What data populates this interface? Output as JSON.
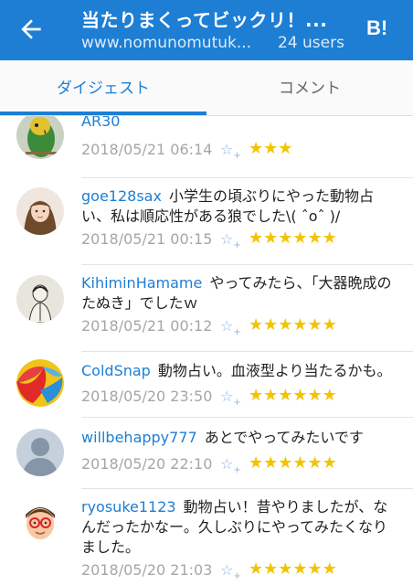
{
  "header": {
    "title": "当たりまくってビックリ！...",
    "url": "www.nomunomutuk...",
    "users": "24 users",
    "hatena_label": "B!"
  },
  "tabs": [
    {
      "label": "ダイジェスト",
      "active": true
    },
    {
      "label": "コメント",
      "active": false
    }
  ],
  "add_star_glyph": "☆",
  "add_star_plus": "+",
  "comments": [
    {
      "user": "AR30",
      "text": "",
      "date": "2018/05/21 06:14",
      "stars": "★★★",
      "star_count": 3
    },
    {
      "user": "goe128sax",
      "text": "小学生の頃ぶりにやった動物占い、私は順応性がある狼でした\\( ˆoˆ )/",
      "date": "2018/05/21 00:15",
      "stars": "★★★★★★",
      "star_count": 6
    },
    {
      "user": "KihiminHamame",
      "text": "やってみたら、「大器晩成のたぬき」でしたｗ",
      "date": "2018/05/21 00:12",
      "stars": "★★★★★★",
      "star_count": 6
    },
    {
      "user": "ColdSnap",
      "text": "動物占い。血液型より当たるかも。",
      "date": "2018/05/20 23:50",
      "stars": "★★★★★★",
      "star_count": 6
    },
    {
      "user": "willbehappy777",
      "text": "あとでやってみたいです",
      "date": "2018/05/20 22:10",
      "stars": "★★★★★★",
      "star_count": 6
    },
    {
      "user": "ryosuke1123",
      "text": "動物占い！昔やりましたが、なんだったかなー。久しぶりにやってみたくなりました。",
      "date": "2018/05/20 21:03",
      "stars": "★★★★★★",
      "star_count": 6
    }
  ],
  "colors": {
    "accent": "#1d7ed4",
    "star": "#f2c400",
    "date": "#a6a6a6"
  }
}
